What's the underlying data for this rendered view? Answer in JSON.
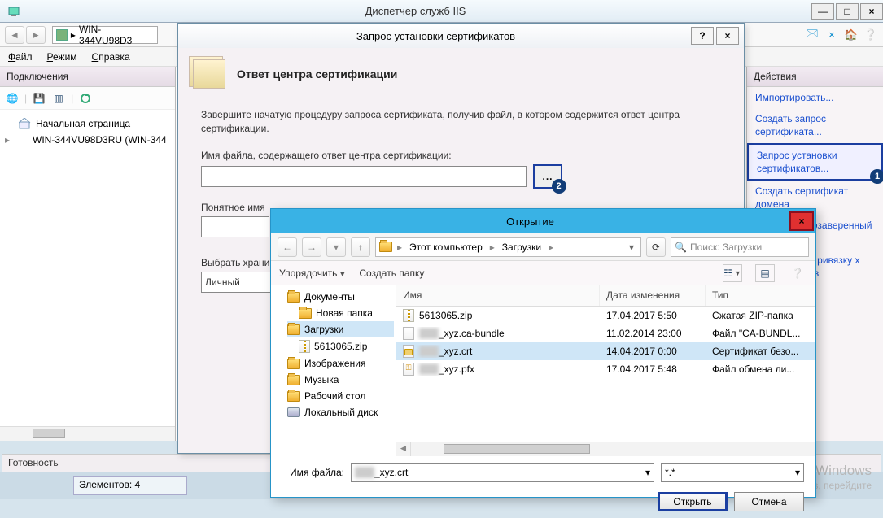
{
  "window": {
    "title": "Диспетчер служб IIS",
    "min": "—",
    "max": "□",
    "close": "×",
    "server_small_icon": "iis-icon",
    "address": "WIN-344VU98D3"
  },
  "navicons": {
    "pin": "📌",
    "bag": "🛍",
    "help": "?",
    "home": "🏠"
  },
  "menubar": {
    "file": "Файл",
    "mode": "Режим",
    "help": "Справка"
  },
  "left": {
    "header": "Подключения",
    "tbicons": [
      "globe",
      "disk",
      "sep",
      "list",
      "refresh"
    ],
    "nodes": [
      {
        "label": "Начальная страница",
        "expander": ""
      },
      {
        "label": "WIN-344VU98D3RU (WIN-344",
        "expander": "▸"
      }
    ]
  },
  "right": {
    "header": "Действия",
    "links": [
      "Импортировать...",
      "Создать запрос сертификата...",
      "Запрос установки сертификатов...",
      "Создать сертификат домена",
      "Создать самозаверенный сертификат",
      "оматическую ривязку х сертификатов"
    ],
    "badge": "1"
  },
  "certModal": {
    "title": "Запрос установки сертификатов",
    "help": "?",
    "close": "×",
    "heading": "Ответ центра сертификации",
    "desc": "Завершите начатую процедуру запроса сертификата, получив файл, в котором содержится ответ центра сертификации.",
    "label_file": "Имя файла, содержащего ответ центра сертификации:",
    "browse": "...",
    "badge": "2",
    "label_name": "Понятное имя",
    "label_store": "Выбрать храни",
    "store_value": "Личный"
  },
  "openModal": {
    "title": "Открытие",
    "close": "×",
    "up": "↑",
    "breadcrumb": [
      "Этот компьютер",
      "Загрузки"
    ],
    "refresh": "⟳",
    "search_ph": "Поиск: Загрузки",
    "tool_org": "Упорядочить",
    "tool_new": "Создать папку",
    "tree": [
      {
        "label": "Документы",
        "type": "folder"
      },
      {
        "label": "Новая папка",
        "type": "folder",
        "indent": true
      },
      {
        "label": "Загрузки",
        "type": "folder",
        "sel": true
      },
      {
        "label": "5613065.zip",
        "type": "zip",
        "indent": true
      },
      {
        "label": "Изображения",
        "type": "folder"
      },
      {
        "label": "Музыка",
        "type": "folder"
      },
      {
        "label": "Рабочий стол",
        "type": "folder"
      },
      {
        "label": "Локальный диск",
        "type": "drive"
      }
    ],
    "cols": {
      "name": "Имя",
      "date": "Дата изменения",
      "type": "Тип"
    },
    "rows": [
      {
        "name": "5613065.zip",
        "date": "17.04.2017 5:50",
        "type": "Сжатая ZIP-папка",
        "icon": "zip"
      },
      {
        "name": "_xyz.ca-bundle",
        "blur_prefix": "xxxx",
        "date": "11.02.2014 23:00",
        "type": "Файл \"CA-BUNDL...",
        "icon": "file"
      },
      {
        "name": "_xyz.crt",
        "blur_prefix": "xxxx",
        "date": "14.04.2017 0:00",
        "type": "Сертификат безо...",
        "icon": "cert",
        "sel": true
      },
      {
        "name": "_xyz.pfx",
        "blur_prefix": "xxxx",
        "date": "17.04.2017 5:48",
        "type": "Файл обмена ли...",
        "icon": "key"
      }
    ],
    "file_lbl": "Имя файла:",
    "file_val": "_xyz.crt",
    "file_blur_prefix": "xxxx",
    "filter_val": "*.*",
    "btn_open": "Открыть",
    "btn_cancel": "Отмена"
  },
  "status": "Готовность",
  "taskbar": {
    "label": "Элементов: 4"
  },
  "watermark": {
    "l1": "Активация Windows",
    "l2": "Чтобы активировать Windows, перейдите"
  }
}
